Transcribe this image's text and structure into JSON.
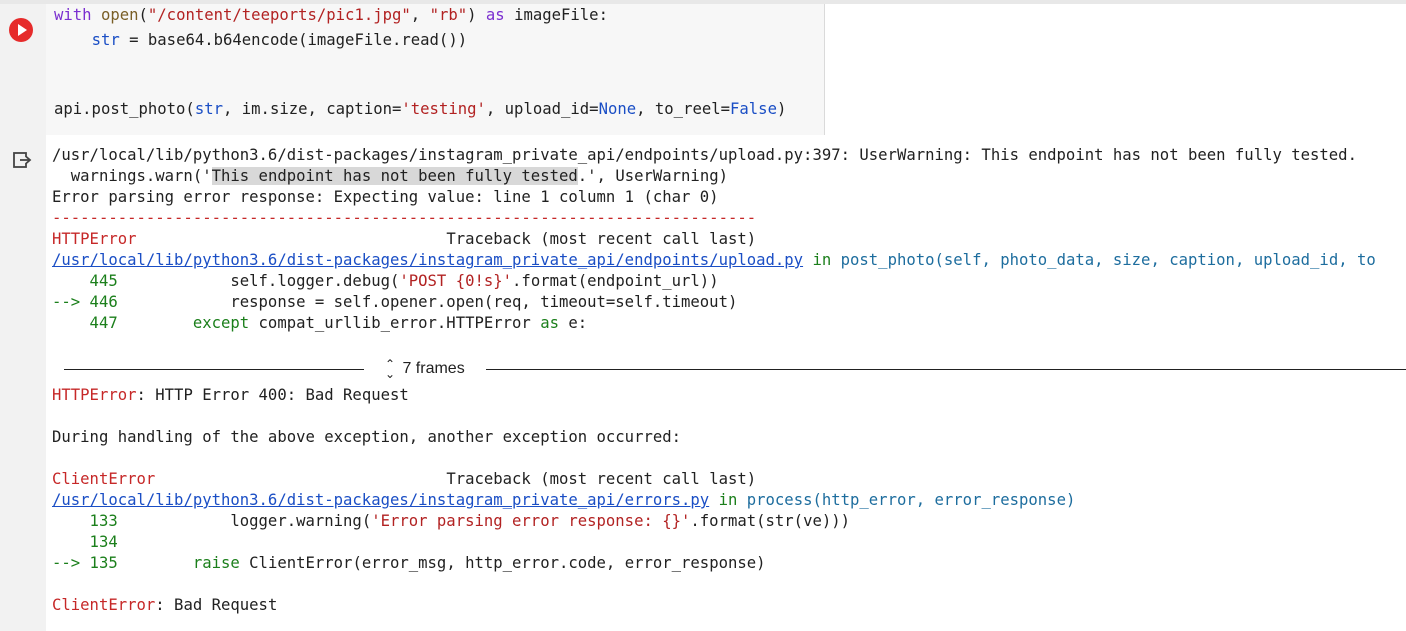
{
  "code": {
    "line1": {
      "with": "with",
      "open": "open",
      "paren_open": "(",
      "path": "\"/content/teeports/pic1.jpg\"",
      "comma": ", ",
      "mode": "\"rb\"",
      "paren_close": ") ",
      "as": "as",
      "rest": " imageFile:"
    },
    "line2": {
      "indent": "    ",
      "var": "str",
      "rest": " = base64.b64encode(imageFile.read())"
    },
    "line3": {
      "call": "api.post_photo(",
      "arg1": "str",
      "mid1": ", im.size, caption=",
      "caption": "'testing'",
      "mid2": ", upload_id=",
      "none": "None",
      "mid3": ", to_reel=",
      "false": "False",
      "end": ")"
    }
  },
  "output": {
    "warn_line": "/usr/local/lib/python3.6/dist-packages/instagram_private_api/endpoints/upload.py:397: UserWarning: This endpoint has not been fully tested.",
    "warn2_pre": "  warnings.warn('",
    "warn2_hl": "This endpoint has not been fully tested",
    "warn2_post": ".', UserWarning)",
    "parse_err": "Error parsing error response: Expecting value: line 1 column 1 (char 0)",
    "dashes": "---------------------------------------------------------------------------",
    "tb1_name": "HTTPError",
    "tb1_gap": "                                 ",
    "tb1_label": "Traceback (most recent call last)",
    "tb1_file": "/usr/local/lib/python3.6/dist-packages/instagram_private_api/endpoints/upload.py",
    "tb1_in": " in ",
    "tb1_func": "post_photo",
    "tb1_args": "(self, photo_data, size, caption, upload_id, to",
    "l445_num": "    445",
    "l445_code": "            self.logger.debug(",
    "l445_str": "'POST {0!s}'",
    "l445_rest": ".format(endpoint_url))",
    "l446_num": "--> 446",
    "l446_code": "            response = self.opener.open(req, timeout=self.timeout)",
    "l447_num": "    447",
    "l447_kw": "        except",
    "l447_rest": " compat_urllib_error.HTTPError ",
    "l447_as": "as",
    "l447_end": " e:",
    "frames_label": "7 frames",
    "http_err_name": "HTTPError",
    "http_err_msg": ": HTTP Error 400: Bad Request",
    "during": "During handling of the above exception, another exception occurred:",
    "tb2_name": "ClientError",
    "tb2_gap": "                               ",
    "tb2_label": "Traceback (most recent call last)",
    "tb2_file": "/usr/local/lib/python3.6/dist-packages/instagram_private_api/errors.py",
    "tb2_in": " in ",
    "tb2_func": "process",
    "tb2_args": "(http_error, error_response)",
    "l133_num": "    133",
    "l133_code": "            logger.warning(",
    "l133_str": "'Error parsing error response: {}'",
    "l133_rest": ".format(str(ve)))",
    "l134_num": "    134",
    "l135_num": "--> 135",
    "l135_kw": "        raise",
    "l135_rest": " ClientError(error_msg, http_error.code, error_response)",
    "final_name": "ClientError",
    "final_msg": ": Bad Request"
  },
  "colors": {
    "run_button": "#e62b2b",
    "error_red": "#c62828",
    "line_green": "#1b7f1b",
    "link_blue": "#1a4ec5"
  }
}
